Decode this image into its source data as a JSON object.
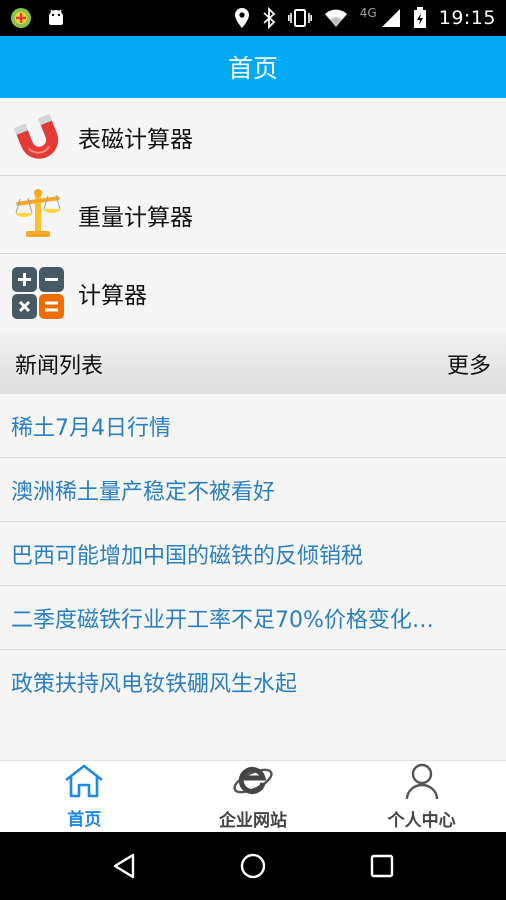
{
  "status_bar": {
    "network": "4G",
    "time": "19:15"
  },
  "header": {
    "title": "首页"
  },
  "tools": [
    {
      "label": "表磁计算器",
      "icon": "magnet-icon"
    },
    {
      "label": "重量计算器",
      "icon": "scale-icon"
    },
    {
      "label": "计算器",
      "icon": "calculator-icon"
    }
  ],
  "news": {
    "title": "新闻列表",
    "more": "更多",
    "items": [
      "稀土7月4日行情",
      "澳洲稀土量产稳定不被看好",
      "巴西可能增加中国的磁铁的反倾销税",
      "二季度磁铁行业开工率不足70%价格变化…",
      "政策扶持风电钕铁硼风生水起"
    ]
  },
  "tabs": [
    {
      "label": "首页",
      "icon": "home-icon",
      "active": true
    },
    {
      "label": "企业网站",
      "icon": "browser-icon",
      "active": false
    },
    {
      "label": "个人中心",
      "icon": "user-icon",
      "active": false
    }
  ],
  "colors": {
    "accent": "#03a9f4",
    "link": "#2a7fc1",
    "active_tab": "#1e88e5"
  }
}
